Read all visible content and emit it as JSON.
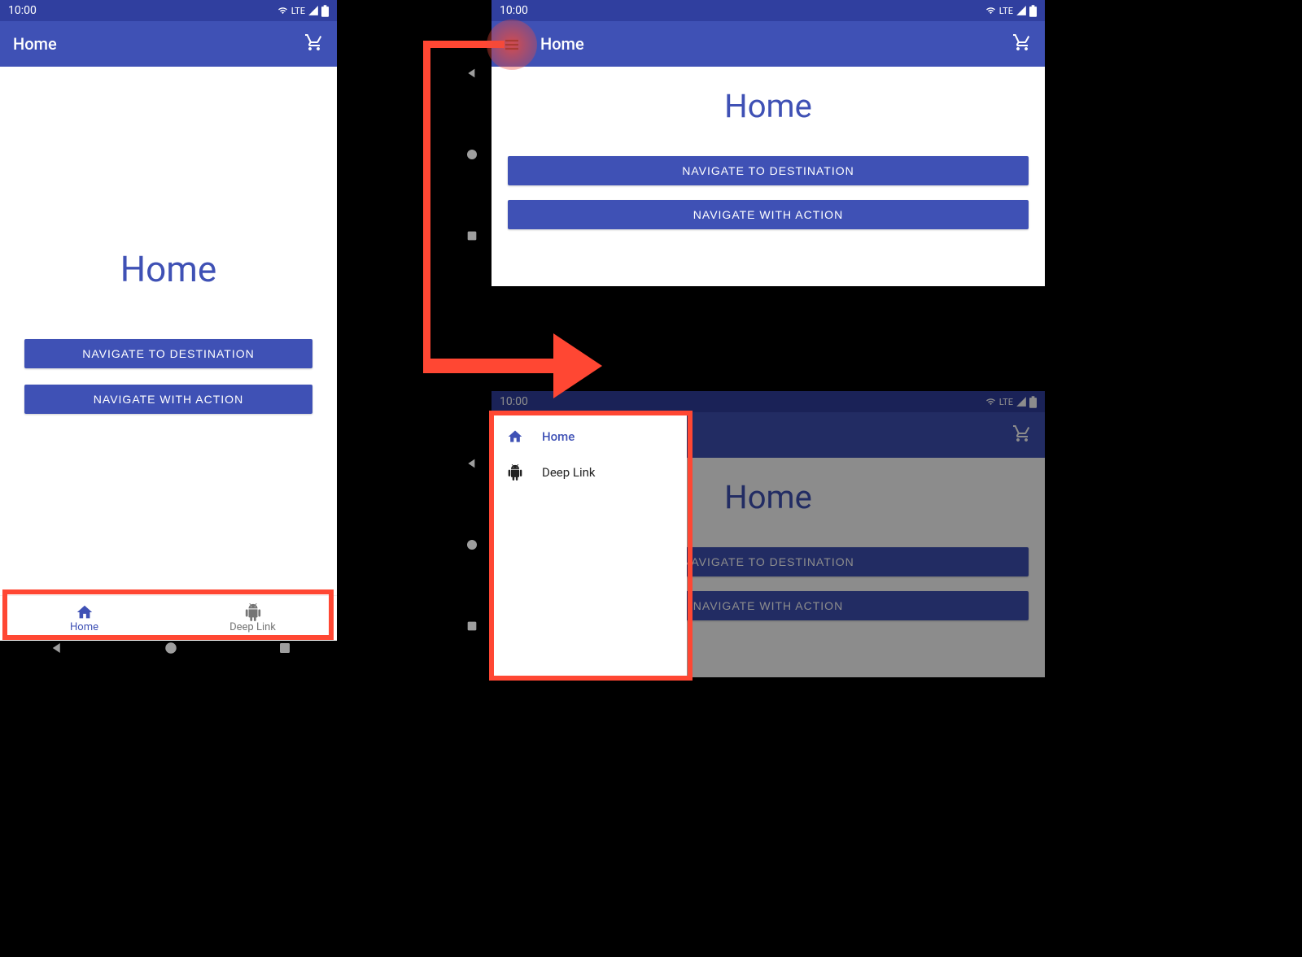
{
  "status": {
    "time": "10:00",
    "network": "LTE"
  },
  "app": {
    "title": "Home",
    "page_title": "Home",
    "buttons": {
      "dest": "NAVIGATE TO DESTINATION",
      "action": "NAVIGATE WITH ACTION"
    }
  },
  "bottom_nav": {
    "items": [
      {
        "label": "Home",
        "active": true
      },
      {
        "label": "Deep Link",
        "active": false
      }
    ]
  },
  "drawer": {
    "items": [
      {
        "label": "Home",
        "active": true
      },
      {
        "label": "Deep Link",
        "active": false
      }
    ]
  }
}
